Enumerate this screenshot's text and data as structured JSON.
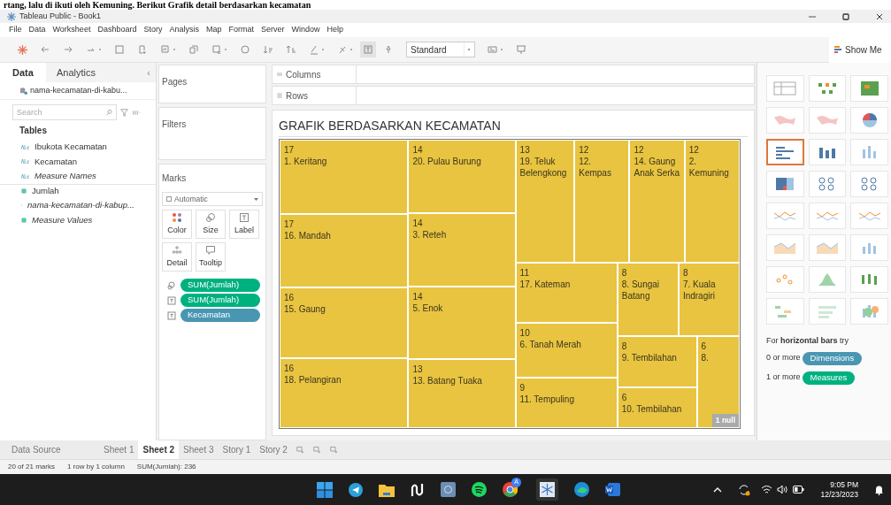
{
  "document_text_above": "rtang, lalu di ikuti oleh Kemuning. Berikut Grafik detail berdasarkan kecamatan",
  "window": {
    "title": "Tableau Public - Book1"
  },
  "menu": [
    "File",
    "Data",
    "Worksheet",
    "Dashboard",
    "Story",
    "Analysis",
    "Map",
    "Format",
    "Server",
    "Window",
    "Help"
  ],
  "toolbar": {
    "fit_dropdown": "Standard",
    "show_me": "Show Me"
  },
  "left_panel": {
    "tabs": [
      {
        "label": "Data",
        "selected": true
      },
      {
        "label": "Analytics",
        "selected": false
      }
    ],
    "collapse": "‹",
    "data_source": "nama-kecamatan-di-kabu...",
    "search": {
      "placeholder": "Search"
    },
    "heading": "Tables",
    "fields": [
      {
        "kind": "dimension",
        "name": "Ibukota Kecamatan",
        "italic": false
      },
      {
        "kind": "dimension",
        "name": "Kecamatan",
        "italic": false
      },
      {
        "kind": "dimension",
        "name": "Measure Names",
        "italic": true
      },
      {
        "kind": "measure",
        "name": "Jumlah",
        "italic": false
      },
      {
        "kind": "measure",
        "name": "nama-kecamatan-di-kabup...",
        "italic": true
      },
      {
        "kind": "measure",
        "name": "Measure Values",
        "italic": true
      }
    ]
  },
  "cards": {
    "pages": "Pages",
    "filters": "Filters",
    "marks": {
      "title": "Marks",
      "mark_type": "Automatic",
      "buttons": [
        "Color",
        "Size",
        "Label",
        "Detail",
        "Tooltip"
      ],
      "pills": [
        {
          "kind": "size",
          "color": "#00b180",
          "label": "SUM(Jumlah)"
        },
        {
          "kind": "label",
          "color": "#00b180",
          "label": "SUM(Jumlah)"
        },
        {
          "kind": "label",
          "color": "#4996b2",
          "label": "Kecamatan"
        }
      ]
    }
  },
  "shelves": {
    "columns": "Columns",
    "rows": "Rows"
  },
  "sheet": {
    "title": "GRAFIK BERDASARKAN KECAMATAN",
    "null_badge": "1 null",
    "treemap": [
      {
        "value": "17",
        "label": "1. Keritang"
      },
      {
        "value": "17",
        "label": "16. Mandah"
      },
      {
        "value": "16",
        "label": "15. Gaung"
      },
      {
        "value": "16",
        "label": "18. Pelangiran"
      },
      {
        "value": "14",
        "label": "20. Pulau Burung"
      },
      {
        "value": "14",
        "label": "3. Reteh"
      },
      {
        "value": "14",
        "label": "5. Enok"
      },
      {
        "value": "13",
        "label": "13. Batang Tuaka"
      },
      {
        "value": "13",
        "label": "19. Teluk Belengkong"
      },
      {
        "value": "12",
        "label": "12. Kempas"
      },
      {
        "value": "12",
        "label": "14. Gaung Anak Serka"
      },
      {
        "value": "12",
        "label": "2. Kemuning"
      },
      {
        "value": "11",
        "label": "17. Kateman"
      },
      {
        "value": "10",
        "label": "6. Tanah Merah"
      },
      {
        "value": "9",
        "label": "11. Tempuling"
      },
      {
        "value": "8",
        "label": "8. Sungai Batang"
      },
      {
        "value": "8",
        "label": "7. Kuala Indragiri"
      },
      {
        "value": "8",
        "label": "9. Tembilahan"
      },
      {
        "value": "6",
        "label": "10. Tembilahan"
      },
      {
        "value": "6",
        "label": "8."
      }
    ]
  },
  "show_me": {
    "chart_types": [
      {
        "selected": false
      },
      {
        "selected": false
      },
      {
        "selected": false
      },
      {
        "selected": false
      },
      {
        "selected": false
      },
      {
        "selected": false
      },
      {
        "selected": true
      },
      {
        "selected": false
      },
      {
        "selected": false
      },
      {
        "selected": false
      },
      {
        "selected": false
      },
      {
        "selected": false
      },
      {
        "selected": false
      },
      {
        "selected": false
      },
      {
        "selected": false
      },
      {
        "selected": false
      },
      {
        "selected": false
      },
      {
        "selected": false
      },
      {
        "selected": false
      },
      {
        "selected": false
      },
      {
        "selected": false
      },
      {
        "selected": false
      },
      {
        "selected": false
      },
      {
        "selected": false
      }
    ],
    "hint": "For **horizontal bars** try",
    "dimensions_prefix": "0 or more",
    "dimensions": "Dimensions",
    "measures_prefix": "1 or more",
    "measures": "Measures"
  },
  "sheet_tabs": [
    {
      "label": "Data Source",
      "selected": false
    },
    {
      "label": "Sheet 1",
      "selected": false
    },
    {
      "label": "Sheet 2",
      "selected": true
    },
    {
      "label": "Sheet 3",
      "selected": false
    },
    {
      "label": "Story 1",
      "selected": false
    },
    {
      "label": "Story 2",
      "selected": false
    }
  ],
  "status_bar": [
    "20 of 21 marks",
    "1 row by 1 column",
    "SUM(Jumlah): 236"
  ],
  "taskbar": {
    "chrome_badge": "A",
    "time": "9:05 PM",
    "date": "12/23/2023"
  }
}
